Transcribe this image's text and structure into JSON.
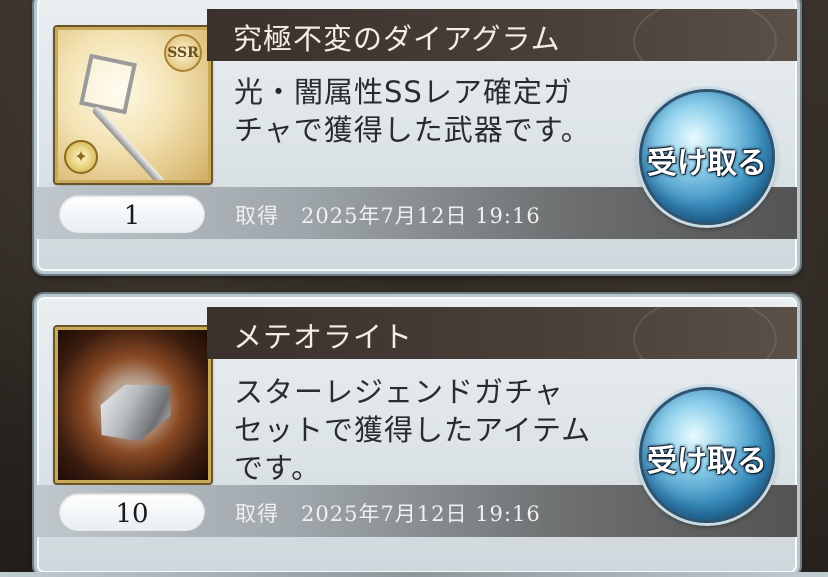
{
  "items": [
    {
      "title": "究極不変のダイアグラム",
      "description": "光・闇属性SSレア確定ガ\nチャで獲得した武器です。",
      "quantity": "1",
      "acquired": "取得　2025年7月12日 19:16",
      "receive_label": "受け取る",
      "rarity": "SSR",
      "icon": "staff-weapon-icon"
    },
    {
      "title": "メテオライト",
      "description": "スターレジェンドガチャ\nセットで獲得したアイテム\nです。",
      "quantity": "10",
      "acquired": "取得　2025年7月12日 19:16",
      "receive_label": "受け取る",
      "icon": "meteorite-icon"
    }
  ],
  "colors": {
    "title_band": "#3b312c",
    "receive_button": "#3b8fbf",
    "card_background": "#e9eef1"
  }
}
